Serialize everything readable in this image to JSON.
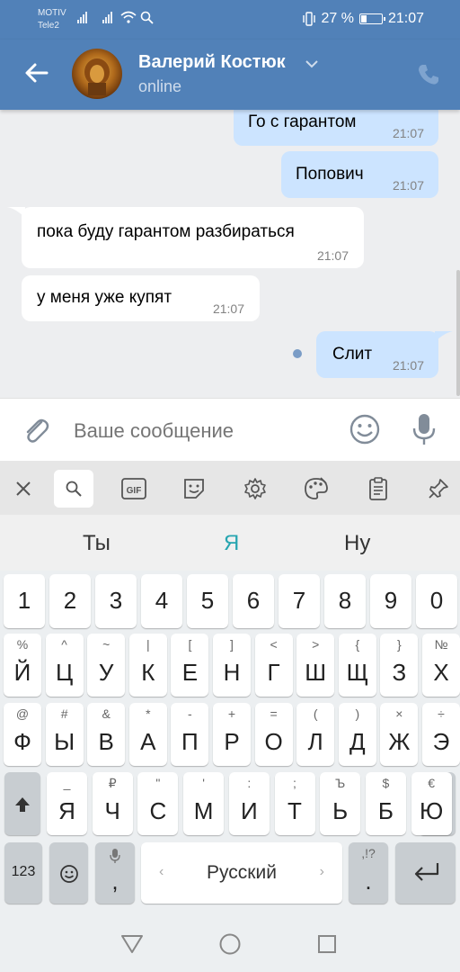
{
  "status_bar": {
    "carrier1": "MOTIV",
    "carrier2": "Tele2",
    "battery": "27 %",
    "time": "21:07"
  },
  "header": {
    "name": "Валерий Костюк",
    "status": "online"
  },
  "messages": [
    {
      "dir": "out",
      "text": "Го с гарантом",
      "time": "21:07"
    },
    {
      "dir": "out",
      "text": "Попович",
      "time": "21:07"
    },
    {
      "dir": "in",
      "text": "пока буду гарантом разбираться",
      "time": "21:07"
    },
    {
      "dir": "in",
      "text": "у меня уже купят",
      "time": "21:07"
    },
    {
      "dir": "out",
      "text": "Слит",
      "time": "21:07"
    }
  ],
  "composer": {
    "placeholder": "Ваше сообщение"
  },
  "keyboard": {
    "suggestions": [
      "Ты",
      "Я",
      "Ну"
    ],
    "digits": [
      "1",
      "2",
      "3",
      "4",
      "5",
      "6",
      "7",
      "8",
      "9",
      "0"
    ],
    "row1": [
      {
        "m": "Й",
        "s": "%"
      },
      {
        "m": "Ц",
        "s": "^"
      },
      {
        "m": "У",
        "s": "~"
      },
      {
        "m": "К",
        "s": "|"
      },
      {
        "m": "Е",
        "s": "["
      },
      {
        "m": "Н",
        "s": "]"
      },
      {
        "m": "Г",
        "s": "<"
      },
      {
        "m": "Ш",
        "s": ">"
      },
      {
        "m": "Щ",
        "s": "{"
      },
      {
        "m": "З",
        "s": "}"
      },
      {
        "m": "Х",
        "s": "№"
      }
    ],
    "row2": [
      {
        "m": "Ф",
        "s": "@"
      },
      {
        "m": "Ы",
        "s": "#"
      },
      {
        "m": "В",
        "s": "&"
      },
      {
        "m": "А",
        "s": "*"
      },
      {
        "m": "П",
        "s": "-"
      },
      {
        "m": "Р",
        "s": "+"
      },
      {
        "m": "О",
        "s": "="
      },
      {
        "m": "Л",
        "s": "("
      },
      {
        "m": "Д",
        "s": ")"
      },
      {
        "m": "Ж",
        "s": "×"
      },
      {
        "m": "Э",
        "s": "÷"
      }
    ],
    "row3": [
      {
        "m": "Я",
        "s": "_"
      },
      {
        "m": "Ч",
        "s": "₽"
      },
      {
        "m": "С",
        "s": "\""
      },
      {
        "m": "М",
        "s": "'"
      },
      {
        "m": "И",
        "s": ":"
      },
      {
        "m": "Т",
        "s": ";"
      },
      {
        "m": "Ь",
        "s": "Ъ"
      },
      {
        "m": "Б",
        "s": "$"
      },
      {
        "m": "Ю",
        "s": "€"
      }
    ],
    "numbers_key": "123",
    "comma": ",",
    "space_label": "Русский",
    "period": ".",
    "period_sub": ",!?"
  },
  "colors": {
    "header": "#5181b8",
    "outgoing": "#cce4ff",
    "suggest_accent": "#26a5b0"
  }
}
